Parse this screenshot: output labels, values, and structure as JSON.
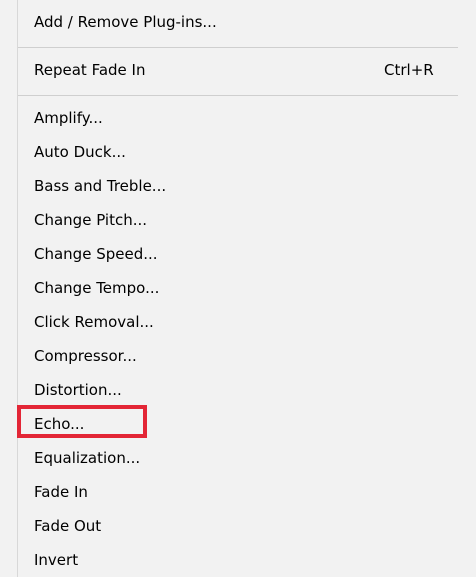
{
  "menu": {
    "top_items": [
      {
        "label": "Add / Remove Plug-ins..."
      }
    ],
    "repeat": {
      "label": "Repeat Fade In",
      "shortcut": "Ctrl+R"
    },
    "effects": [
      {
        "label": "Amplify..."
      },
      {
        "label": "Auto Duck..."
      },
      {
        "label": "Bass and Treble..."
      },
      {
        "label": "Change Pitch..."
      },
      {
        "label": "Change Speed..."
      },
      {
        "label": "Change Tempo..."
      },
      {
        "label": "Click Removal..."
      },
      {
        "label": "Compressor..."
      },
      {
        "label": "Distortion..."
      },
      {
        "label": "Echo..."
      },
      {
        "label": "Equalization..."
      },
      {
        "label": "Fade In"
      },
      {
        "label": "Fade Out"
      },
      {
        "label": "Invert"
      }
    ],
    "highlight_color": "#e32636"
  }
}
